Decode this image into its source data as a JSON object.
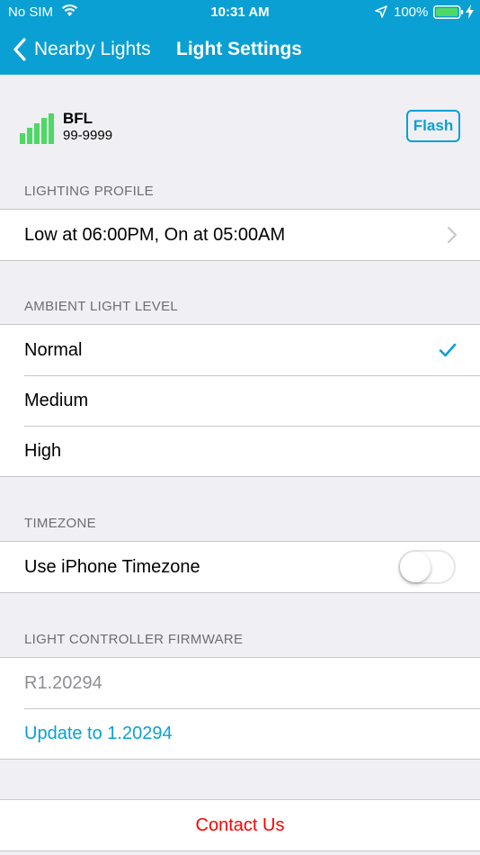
{
  "status_bar": {
    "carrier": "No SIM",
    "time": "10:31 AM",
    "battery_pct": "100%"
  },
  "nav": {
    "back_label": "Nearby Lights",
    "title": "Light Settings"
  },
  "device": {
    "name": "BFL",
    "id": "99-9999",
    "flash_label": "Flash"
  },
  "lighting_profile": {
    "header": "LIGHTING PROFILE",
    "value": "Low at 06:00PM, On at 05:00AM"
  },
  "ambient": {
    "header": "AMBIENT LIGHT LEVEL",
    "options": [
      {
        "label": "Normal",
        "selected": true
      },
      {
        "label": "Medium",
        "selected": false
      },
      {
        "label": "High",
        "selected": false
      }
    ]
  },
  "timezone": {
    "header": "TIMEZONE",
    "label": "Use iPhone Timezone",
    "enabled": false
  },
  "firmware": {
    "header": "LIGHT CONTROLLER FIRMWARE",
    "current": "R1.20294",
    "update_label": "Update to 1.20294"
  },
  "contact": {
    "label": "Contact Us"
  },
  "colors": {
    "accent": "#0aa0d4",
    "signal": "#4cd964",
    "danger": "#ff0000"
  }
}
